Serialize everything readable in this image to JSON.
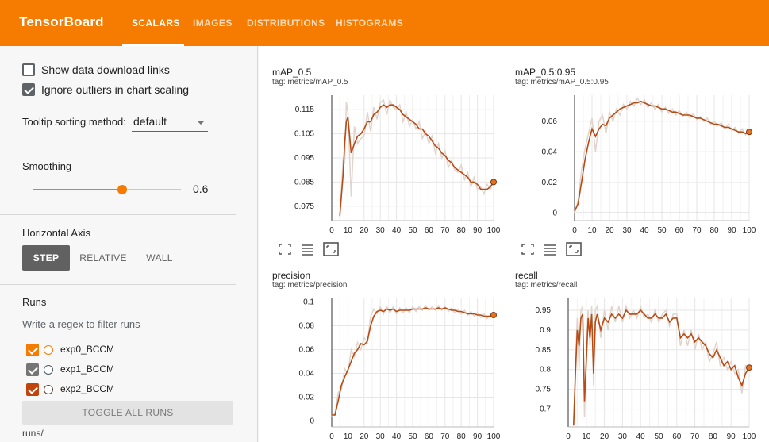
{
  "app": {
    "title": "TensorBoard"
  },
  "tabs": [
    {
      "label": "SCALARS",
      "active": true
    },
    {
      "label": "IMAGES",
      "active": false
    },
    {
      "label": "DISTRIBUTIONS",
      "active": false
    },
    {
      "label": "HISTOGRAMS",
      "active": false
    }
  ],
  "sidebar": {
    "show_download_label": "Show data download links",
    "show_download_checked": false,
    "ignore_outliers_label": "Ignore outliers in chart scaling",
    "ignore_outliers_checked": true,
    "tooltip_label": "Tooltip sorting method:",
    "tooltip_value": "default",
    "smoothing_title": "Smoothing",
    "smoothing_value": "0.6",
    "smoothing_fraction": 0.6,
    "haxis_title": "Horizontal Axis",
    "haxis_options": [
      {
        "label": "STEP",
        "active": true
      },
      {
        "label": "RELATIVE",
        "active": false
      },
      {
        "label": "WALL",
        "active": false
      }
    ],
    "runs_title": "Runs",
    "runs_filter_placeholder": "Write a regex to filter runs",
    "runs": [
      {
        "name": "exp0_BCCM",
        "checked": true,
        "color": "#f57c00"
      },
      {
        "name": "exp1_BCCM",
        "checked": true,
        "color": "#757575"
      },
      {
        "name": "exp2_BCCM",
        "checked": true,
        "color": "#c0440c"
      }
    ],
    "toggle_all_label": "TOGGLE ALL RUNS",
    "runs_path": "runs/"
  },
  "colors": {
    "accent": "#f57c00",
    "series_smoothed": "#b84a13",
    "series_raw": "#e0d4cc",
    "endpoint": "#e8711f"
  },
  "chart_data": [
    {
      "type": "line",
      "title": "mAP_0.5",
      "tag": "tag: metrics/mAP_0.5",
      "xticks": [
        "0",
        "10",
        "20",
        "30",
        "40",
        "50",
        "60",
        "70",
        "80",
        "90",
        "100"
      ],
      "yticks": [
        "0.075",
        "0.085",
        "0.095",
        "0.105",
        "0.115"
      ],
      "xlim": [
        0,
        100
      ],
      "ylim": [
        0.069,
        0.121
      ],
      "x": [
        5,
        7,
        8,
        9,
        10,
        12,
        14,
        16,
        18,
        20,
        22,
        24,
        26,
        28,
        30,
        32,
        34,
        36,
        38,
        40,
        42,
        44,
        46,
        48,
        50,
        52,
        54,
        56,
        58,
        60,
        62,
        64,
        66,
        68,
        70,
        72,
        74,
        76,
        78,
        80,
        82,
        84,
        86,
        88,
        90,
        92,
        94,
        96,
        98,
        100
      ],
      "y_smoothed": [
        0.071,
        0.088,
        0.101,
        0.11,
        0.112,
        0.097,
        0.101,
        0.104,
        0.105,
        0.107,
        0.11,
        0.11,
        0.113,
        0.114,
        0.116,
        0.117,
        0.116,
        0.117,
        0.117,
        0.116,
        0.115,
        0.113,
        0.112,
        0.111,
        0.11,
        0.109,
        0.107,
        0.107,
        0.105,
        0.104,
        0.102,
        0.1,
        0.099,
        0.097,
        0.096,
        0.094,
        0.093,
        0.091,
        0.09,
        0.089,
        0.088,
        0.087,
        0.085,
        0.085,
        0.084,
        0.082,
        0.082,
        0.082,
        0.083,
        0.085
      ],
      "y_raw": [
        0.07,
        0.094,
        0.093,
        0.118,
        0.114,
        0.079,
        0.108,
        0.101,
        0.103,
        0.104,
        0.114,
        0.106,
        0.116,
        0.111,
        0.118,
        0.119,
        0.113,
        0.119,
        0.116,
        0.115,
        0.117,
        0.11,
        0.114,
        0.108,
        0.111,
        0.107,
        0.11,
        0.103,
        0.106,
        0.101,
        0.104,
        0.097,
        0.101,
        0.095,
        0.098,
        0.091,
        0.094,
        0.09,
        0.089,
        0.092,
        0.086,
        0.089,
        0.083,
        0.087,
        0.082,
        0.083,
        0.08,
        0.084,
        0.082,
        0.086
      ]
    },
    {
      "type": "line",
      "title": "mAP_0.5:0.95",
      "tag": "tag: metrics/mAP_0.5:0.95",
      "xticks": [
        "0",
        "10",
        "20",
        "30",
        "40",
        "50",
        "60",
        "70",
        "80",
        "90",
        "100"
      ],
      "yticks": [
        "0",
        "0.02",
        "0.04",
        "0.06"
      ],
      "xlim": [
        0,
        100
      ],
      "ylim": [
        -0.005,
        0.077
      ],
      "x": [
        0,
        2,
        4,
        6,
        8,
        10,
        12,
        14,
        16,
        18,
        20,
        22,
        24,
        26,
        28,
        30,
        32,
        34,
        36,
        38,
        40,
        42,
        44,
        46,
        48,
        50,
        52,
        54,
        56,
        58,
        60,
        62,
        64,
        66,
        68,
        70,
        72,
        74,
        76,
        78,
        80,
        82,
        84,
        86,
        88,
        90,
        92,
        94,
        96,
        98,
        100
      ],
      "y_smoothed": [
        0.001,
        0.006,
        0.02,
        0.035,
        0.046,
        0.055,
        0.05,
        0.055,
        0.058,
        0.057,
        0.062,
        0.064,
        0.066,
        0.068,
        0.069,
        0.07,
        0.071,
        0.072,
        0.072,
        0.073,
        0.072,
        0.071,
        0.07,
        0.07,
        0.069,
        0.068,
        0.068,
        0.067,
        0.066,
        0.066,
        0.065,
        0.064,
        0.064,
        0.064,
        0.063,
        0.062,
        0.062,
        0.061,
        0.06,
        0.059,
        0.058,
        0.058,
        0.057,
        0.056,
        0.056,
        0.055,
        0.054,
        0.053,
        0.053,
        0.052,
        0.053
      ],
      "y_raw": [
        0.0,
        0.008,
        0.028,
        0.042,
        0.052,
        0.062,
        0.04,
        0.06,
        0.064,
        0.052,
        0.066,
        0.06,
        0.068,
        0.064,
        0.071,
        0.068,
        0.073,
        0.07,
        0.075,
        0.071,
        0.074,
        0.069,
        0.072,
        0.068,
        0.071,
        0.066,
        0.069,
        0.065,
        0.068,
        0.064,
        0.067,
        0.063,
        0.066,
        0.062,
        0.065,
        0.061,
        0.063,
        0.06,
        0.062,
        0.058,
        0.06,
        0.057,
        0.059,
        0.055,
        0.058,
        0.054,
        0.056,
        0.052,
        0.055,
        0.051,
        0.054
      ]
    },
    {
      "type": "line",
      "title": "precision",
      "tag": "tag: metrics/precision",
      "xticks": [
        "0",
        "10",
        "20",
        "30",
        "40",
        "50",
        "60",
        "70",
        "80",
        "90",
        "100"
      ],
      "yticks": [
        "0",
        "0.02",
        "0.04",
        "0.06",
        "0.08",
        "0.1"
      ],
      "xlim": [
        0,
        100
      ],
      "ylim": [
        -0.005,
        0.103
      ],
      "x": [
        0,
        2,
        4,
        6,
        8,
        10,
        12,
        14,
        16,
        18,
        20,
        22,
        24,
        26,
        28,
        30,
        32,
        34,
        36,
        38,
        40,
        42,
        44,
        46,
        48,
        50,
        52,
        54,
        56,
        58,
        60,
        62,
        64,
        66,
        68,
        70,
        72,
        74,
        76,
        78,
        80,
        82,
        84,
        86,
        88,
        90,
        92,
        94,
        96,
        98,
        100
      ],
      "y_smoothed": [
        0.005,
        0.005,
        0.017,
        0.03,
        0.037,
        0.043,
        0.05,
        0.057,
        0.06,
        0.065,
        0.064,
        0.067,
        0.08,
        0.088,
        0.092,
        0.093,
        0.092,
        0.094,
        0.093,
        0.094,
        0.092,
        0.093,
        0.093,
        0.093,
        0.093,
        0.094,
        0.094,
        0.094,
        0.094,
        0.095,
        0.094,
        0.094,
        0.094,
        0.095,
        0.094,
        0.095,
        0.094,
        0.093,
        0.093,
        0.092,
        0.092,
        0.091,
        0.09,
        0.09,
        0.09,
        0.089,
        0.089,
        0.088,
        0.088,
        0.088,
        0.089
      ],
      "y_raw": [
        0.004,
        0.006,
        0.024,
        0.026,
        0.044,
        0.04,
        0.06,
        0.054,
        0.066,
        0.06,
        0.07,
        0.066,
        0.088,
        0.094,
        0.09,
        0.096,
        0.09,
        0.096,
        0.091,
        0.096,
        0.09,
        0.095,
        0.091,
        0.095,
        0.091,
        0.096,
        0.092,
        0.096,
        0.093,
        0.097,
        0.093,
        0.096,
        0.093,
        0.097,
        0.093,
        0.096,
        0.092,
        0.095,
        0.091,
        0.094,
        0.09,
        0.093,
        0.089,
        0.092,
        0.088,
        0.091,
        0.087,
        0.09,
        0.086,
        0.089,
        0.088
      ]
    },
    {
      "type": "line",
      "title": "recall",
      "tag": "tag: metrics/recall",
      "xticks": [
        "0",
        "10",
        "20",
        "30",
        "40",
        "50",
        "60",
        "70",
        "80",
        "90",
        "100"
      ],
      "yticks": [
        "0.7",
        "0.75",
        "0.8",
        "0.85",
        "0.9",
        "0.95"
      ],
      "xlim": [
        0,
        100
      ],
      "ylim": [
        0.655,
        0.98
      ],
      "x": [
        3,
        4,
        5,
        6,
        7,
        8,
        9,
        10,
        11,
        12,
        13,
        14,
        15,
        16,
        18,
        20,
        22,
        24,
        26,
        28,
        30,
        32,
        34,
        36,
        38,
        40,
        42,
        44,
        46,
        48,
        50,
        52,
        54,
        56,
        58,
        60,
        62,
        64,
        66,
        68,
        70,
        72,
        74,
        76,
        78,
        80,
        82,
        84,
        86,
        88,
        90,
        92,
        94,
        96,
        98,
        100
      ],
      "y_smoothed": [
        0.66,
        0.79,
        0.9,
        0.86,
        0.93,
        0.94,
        0.72,
        0.82,
        0.93,
        0.88,
        0.94,
        0.79,
        0.92,
        0.94,
        0.9,
        0.93,
        0.92,
        0.94,
        0.93,
        0.94,
        0.93,
        0.95,
        0.94,
        0.94,
        0.94,
        0.95,
        0.94,
        0.93,
        0.93,
        0.94,
        0.93,
        0.93,
        0.94,
        0.92,
        0.93,
        0.93,
        0.88,
        0.89,
        0.88,
        0.89,
        0.87,
        0.88,
        0.87,
        0.86,
        0.84,
        0.83,
        0.85,
        0.83,
        0.81,
        0.82,
        0.8,
        0.81,
        0.78,
        0.76,
        0.79,
        0.805
      ],
      "y_raw": [
        0.65,
        0.82,
        0.93,
        0.8,
        0.95,
        0.96,
        0.68,
        0.85,
        0.95,
        0.86,
        0.96,
        0.76,
        0.95,
        0.96,
        0.88,
        0.95,
        0.9,
        0.96,
        0.92,
        0.96,
        0.92,
        0.96,
        0.93,
        0.95,
        0.93,
        0.96,
        0.93,
        0.94,
        0.92,
        0.95,
        0.92,
        0.94,
        0.95,
        0.91,
        0.94,
        0.94,
        0.86,
        0.9,
        0.86,
        0.9,
        0.85,
        0.89,
        0.85,
        0.87,
        0.82,
        0.84,
        0.87,
        0.81,
        0.83,
        0.8,
        0.82,
        0.79,
        0.8,
        0.74,
        0.81,
        0.81
      ]
    }
  ]
}
